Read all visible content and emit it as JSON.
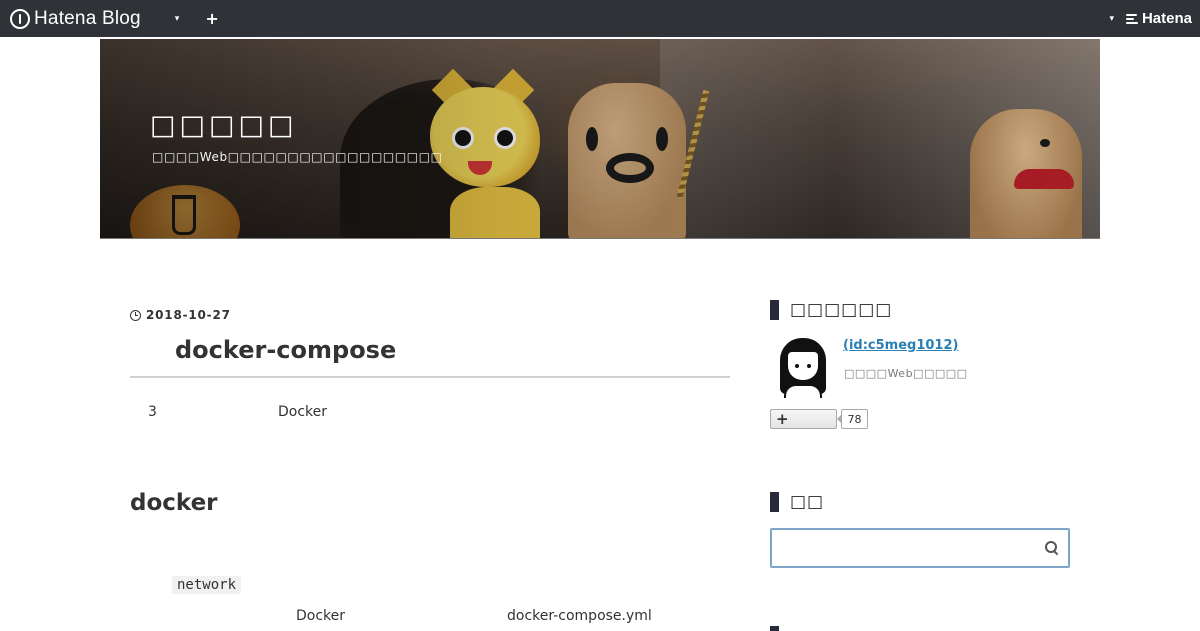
{
  "topbar": {
    "brand_label": "Hatena Blog",
    "menu_caret": "▾",
    "add_label": "+",
    "right_caret": "▾",
    "hatena_label": "Hatena"
  },
  "header": {
    "blog_title": "□□□□□",
    "blog_description": "□□□□Web□□□□□□□□□□□□□□□□□□"
  },
  "article": {
    "date": "2018-10-27",
    "title": "docker-compose",
    "intro_number": "3",
    "intro_word": "Docker",
    "section_heading": "docker",
    "code_token": "network",
    "body_word_docker": "Docker",
    "body_word_yml": "docker-compose.yml"
  },
  "sidebar": {
    "profile": {
      "title": "□□□□□□",
      "name": " (id:c5meg1012)",
      "description": "□□□□Web□□□□□",
      "follow_icon": "+",
      "follow_count": "78"
    },
    "search": {
      "title": "□□",
      "placeholder": ""
    }
  },
  "colors": {
    "topbar_bg": "#2f3236",
    "module_bar": "#262a3a",
    "link": "#2a7fb5",
    "search_border": "#7fa3c8"
  }
}
